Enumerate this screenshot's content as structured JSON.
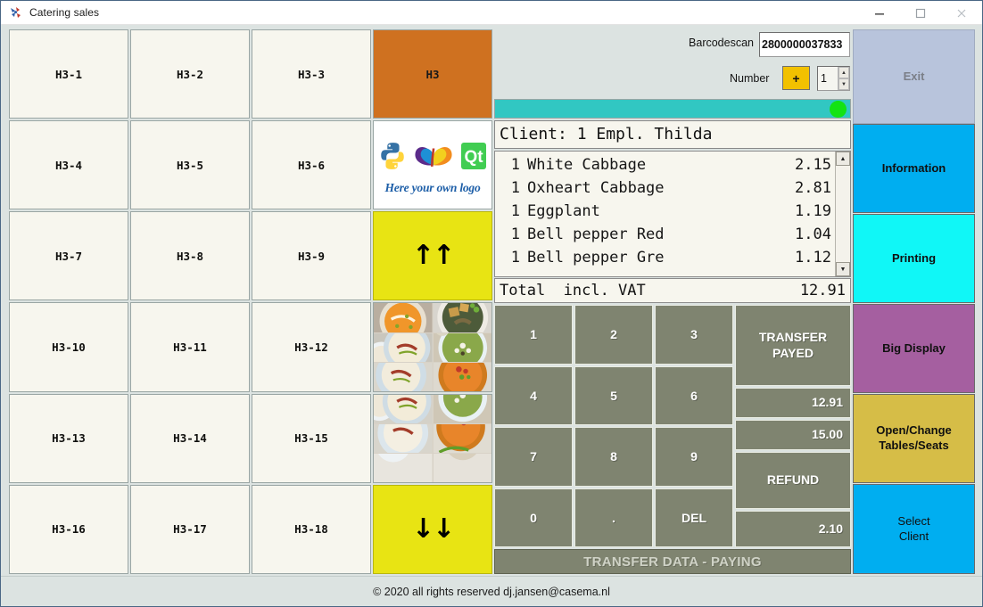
{
  "window": {
    "title": "Catering sales",
    "icon": "app-logo-icon",
    "minimize": "minimize-icon",
    "maximize": "maximize-icon",
    "close": "close-icon"
  },
  "product_grid": {
    "cells": [
      {
        "label": "H3-1",
        "kind": "product"
      },
      {
        "label": "H3-2",
        "kind": "product"
      },
      {
        "label": "H3-3",
        "kind": "product"
      },
      {
        "label": "H3",
        "kind": "header"
      },
      {
        "label": "H3-4",
        "kind": "product"
      },
      {
        "label": "H3-5",
        "kind": "product"
      },
      {
        "label": "H3-6",
        "kind": "product"
      },
      {
        "label": "",
        "kind": "logo"
      },
      {
        "label": "H3-7",
        "kind": "product"
      },
      {
        "label": "H3-8",
        "kind": "product"
      },
      {
        "label": "H3-9",
        "kind": "product"
      },
      {
        "label": "↑↑",
        "kind": "scroll-up"
      },
      {
        "label": "H3-10",
        "kind": "product"
      },
      {
        "label": "H3-11",
        "kind": "product"
      },
      {
        "label": "H3-12",
        "kind": "product"
      },
      {
        "label": "",
        "kind": "photo"
      },
      {
        "label": "H3-13",
        "kind": "product"
      },
      {
        "label": "H3-14",
        "kind": "product"
      },
      {
        "label": "H3-15",
        "kind": "product"
      },
      {
        "label": "",
        "kind": "photo-cont"
      },
      {
        "label": "H3-16",
        "kind": "product"
      },
      {
        "label": "H3-17",
        "kind": "product"
      },
      {
        "label": "H3-18",
        "kind": "product"
      },
      {
        "label": "↓↓",
        "kind": "scroll-down"
      }
    ],
    "logo_caption": "Here your own logo"
  },
  "toolbar": {
    "barcode_label": "Barcodescan",
    "barcode_value": "2800000037833",
    "number_label": "Number",
    "plus_label": "+",
    "number_value": "1"
  },
  "status": {
    "indicator": "green",
    "indicator_color": "#13e313",
    "bar_color": "#31c7c2"
  },
  "receipt": {
    "client_line": "Client: 1 Empl. Thilda",
    "items": [
      {
        "qty": "1",
        "name": "White Cabbage",
        "amount": "2.15"
      },
      {
        "qty": "1",
        "name": "Oxheart Cabbage",
        "amount": "2.81"
      },
      {
        "qty": "1",
        "name": "Eggplant",
        "amount": "1.19"
      },
      {
        "qty": "1",
        "name": "Bell pepper Red",
        "amount": "1.04"
      },
      {
        "qty": "1",
        "name": "Bell pepper Gre",
        "amount": "1.12"
      }
    ],
    "total_label": "Total  incl. VAT",
    "total_amount": "12.91",
    "scroll_up": "scroll-up-icon",
    "scroll_down": "scroll-down-icon"
  },
  "keypad": {
    "keys": [
      "1",
      "2",
      "3",
      "4",
      "5",
      "6",
      "7",
      "8",
      "9",
      "0",
      ".",
      "DEL"
    ]
  },
  "payment": {
    "transfer_payed": "TRANSFER\nPAYED",
    "transfer_payed_line1": "TRANSFER",
    "transfer_payed_line2": "PAYED",
    "due_amount": "12.91",
    "given_amount": "15.00",
    "refund_label": "REFUND",
    "refund_amount": "2.10",
    "transfer_status": "TRANSFER DATA - PAYING"
  },
  "sidebar": {
    "items": [
      {
        "label": "Exit",
        "color": "#b8c4dc",
        "enabled": false
      },
      {
        "label": "Information",
        "color": "#00aef0",
        "enabled": true
      },
      {
        "label": "Printing",
        "color": "#10f7f7",
        "enabled": true
      },
      {
        "label": "Big Display",
        "color": "#a55fa0",
        "enabled": true
      },
      {
        "label": "Open/Change Tables/Seats",
        "color": "#d6bd47",
        "enabled": true
      },
      {
        "label": "Select Client",
        "color": "#00aef0",
        "enabled": true
      }
    ],
    "tables_line1": "Open/Change",
    "tables_line2": "Tables/Seats",
    "client_line1": "Select",
    "client_line2": "Client"
  },
  "footer": {
    "text": "© 2020 all rights reserved dj.jansen@casema.nl"
  }
}
